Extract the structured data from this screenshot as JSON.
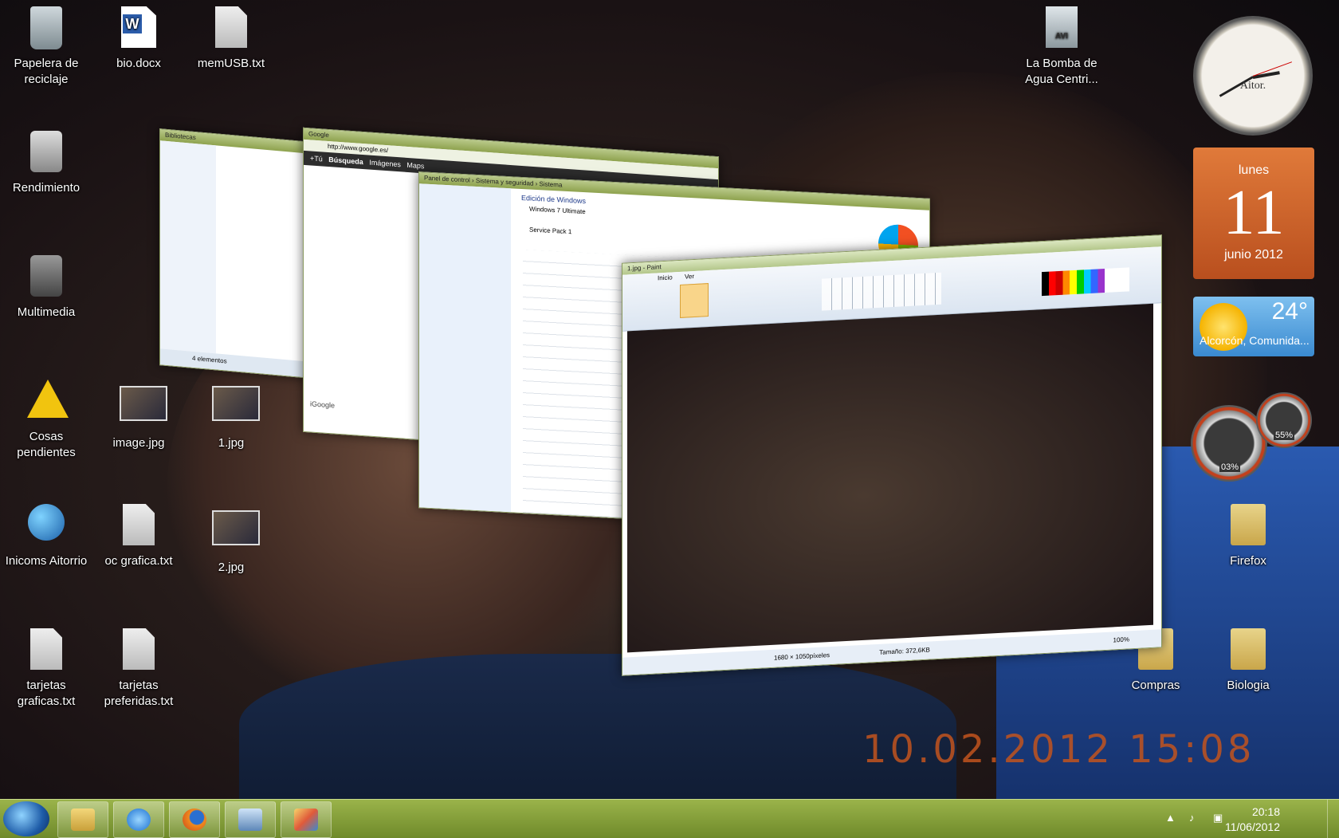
{
  "desktop": {
    "icons": [
      {
        "label": "Papelera de reciclaje",
        "icon": "recycle-bin-icon"
      },
      {
        "label": "bio.docx",
        "icon": "word-document-icon"
      },
      {
        "label": "memUSB.txt",
        "icon": "text-file-icon"
      },
      {
        "label": "Rendimiento",
        "icon": "performance-icon"
      },
      {
        "label": "Multimedia",
        "icon": "speaker-icon"
      },
      {
        "label": "Cosas pendientes",
        "icon": "warning-icon"
      },
      {
        "label": "image.jpg",
        "icon": "image-file-icon"
      },
      {
        "label": "1.jpg",
        "icon": "image-file-icon"
      },
      {
        "label": "Inicoms Aitorrio",
        "icon": "network-computer-icon"
      },
      {
        "label": "oc grafica.txt",
        "icon": "text-file-icon"
      },
      {
        "label": "2.jpg",
        "icon": "image-file-icon"
      },
      {
        "label": "tarjetas graficas.txt",
        "icon": "text-file-icon"
      },
      {
        "label": "tarjetas preferidas.txt",
        "icon": "text-file-icon"
      },
      {
        "label": "La Bomba de Agua Centri...",
        "icon": "avi-video-icon"
      },
      {
        "label": "Firefox",
        "icon": "folder-icon"
      },
      {
        "label": "Compras",
        "icon": "folder-icon"
      },
      {
        "label": "Biologia",
        "icon": "folder-icon"
      }
    ],
    "wallpaper_timestamp": "10.02.2012  15:08"
  },
  "windows": {
    "explorer_title": "Bibliotecas",
    "explorer_items": "4 elementos",
    "browser_url": "http://www.google.es/",
    "browser_tab": "Google",
    "browser_nav": [
      "+Tú",
      "Búsqueda",
      "Imágenes",
      "Maps"
    ],
    "browser_footer": "iGoogle",
    "cpanel_path": "Panel de control › Sistema y seguridad › Sistema",
    "cpanel_heading": "Edición de Windows",
    "cpanel_edition": "Windows 7 Ultimate",
    "cpanel_sp": "Service Pack 1",
    "paint_title": "1.jpg - Paint",
    "paint_tabs": [
      "Inicio",
      "Ver"
    ],
    "paint_status_size": "1680 × 1050píxeles",
    "paint_status_file": "Tamaño: 372,6KB",
    "paint_zoom": "100%"
  },
  "gadgets": {
    "clock_brand": "Aitor.",
    "calendar_dow": "lunes",
    "calendar_day": "11",
    "calendar_month": "junio 2012",
    "weather_temp": "24°",
    "weather_location": "Alcorcón, Comunida...",
    "cpu_meter": "03%",
    "ram_meter": "55%"
  },
  "taskbar": {
    "pinned": [
      "explorer-icon",
      "internet-explorer-icon",
      "firefox-icon",
      "remote-desktop-icon",
      "paint-icon"
    ],
    "time": "20:18",
    "date": "11/06/2012"
  }
}
